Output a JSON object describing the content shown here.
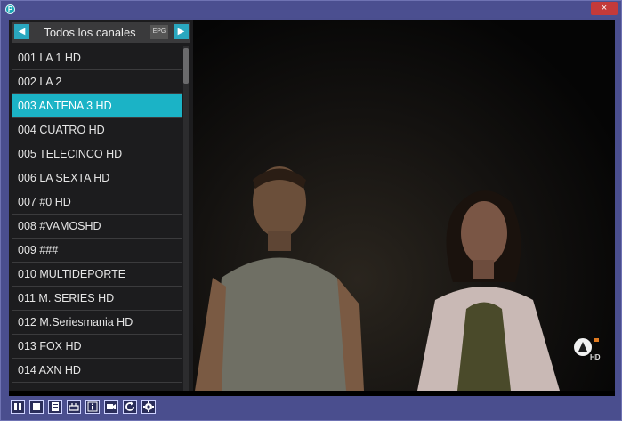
{
  "window": {
    "app_icon_letter": "P",
    "close_glyph": "×"
  },
  "sidebar": {
    "group_title": "Todos los canales",
    "epg_label": "EPG",
    "prev_glyph": "◀",
    "next_glyph": "▶",
    "channels": [
      {
        "label": "001 LA 1 HD",
        "selected": false
      },
      {
        "label": "002 LA 2",
        "selected": false
      },
      {
        "label": "003 ANTENA 3 HD",
        "selected": true
      },
      {
        "label": "004 CUATRO HD",
        "selected": false
      },
      {
        "label": "005 TELECINCO HD",
        "selected": false
      },
      {
        "label": "006 LA SEXTA HD",
        "selected": false
      },
      {
        "label": "007 #0 HD",
        "selected": false
      },
      {
        "label": "008 #VAMOSHD",
        "selected": false
      },
      {
        "label": "009 ###",
        "selected": false
      },
      {
        "label": "010 MULTIDEPORTE",
        "selected": false
      },
      {
        "label": "011 M. SERIES HD",
        "selected": false
      },
      {
        "label": "012 M.Seriesmania HD",
        "selected": false
      },
      {
        "label": "013 FOX HD",
        "selected": false
      },
      {
        "label": "014 AXN HD",
        "selected": false
      }
    ]
  },
  "video": {
    "channel_logo_text": "HD"
  },
  "toolbar": {
    "buttons": [
      {
        "name": "pause-icon"
      },
      {
        "name": "stop-icon"
      },
      {
        "name": "record-list-icon"
      },
      {
        "name": "subtitles-icon"
      },
      {
        "name": "info-icon"
      },
      {
        "name": "camera-icon"
      },
      {
        "name": "refresh-icon"
      },
      {
        "name": "settings-gear-icon"
      }
    ]
  },
  "colors": {
    "accent": "#1bb3c6",
    "window_frame": "#4a4e8e",
    "close": "#c43a3a"
  }
}
